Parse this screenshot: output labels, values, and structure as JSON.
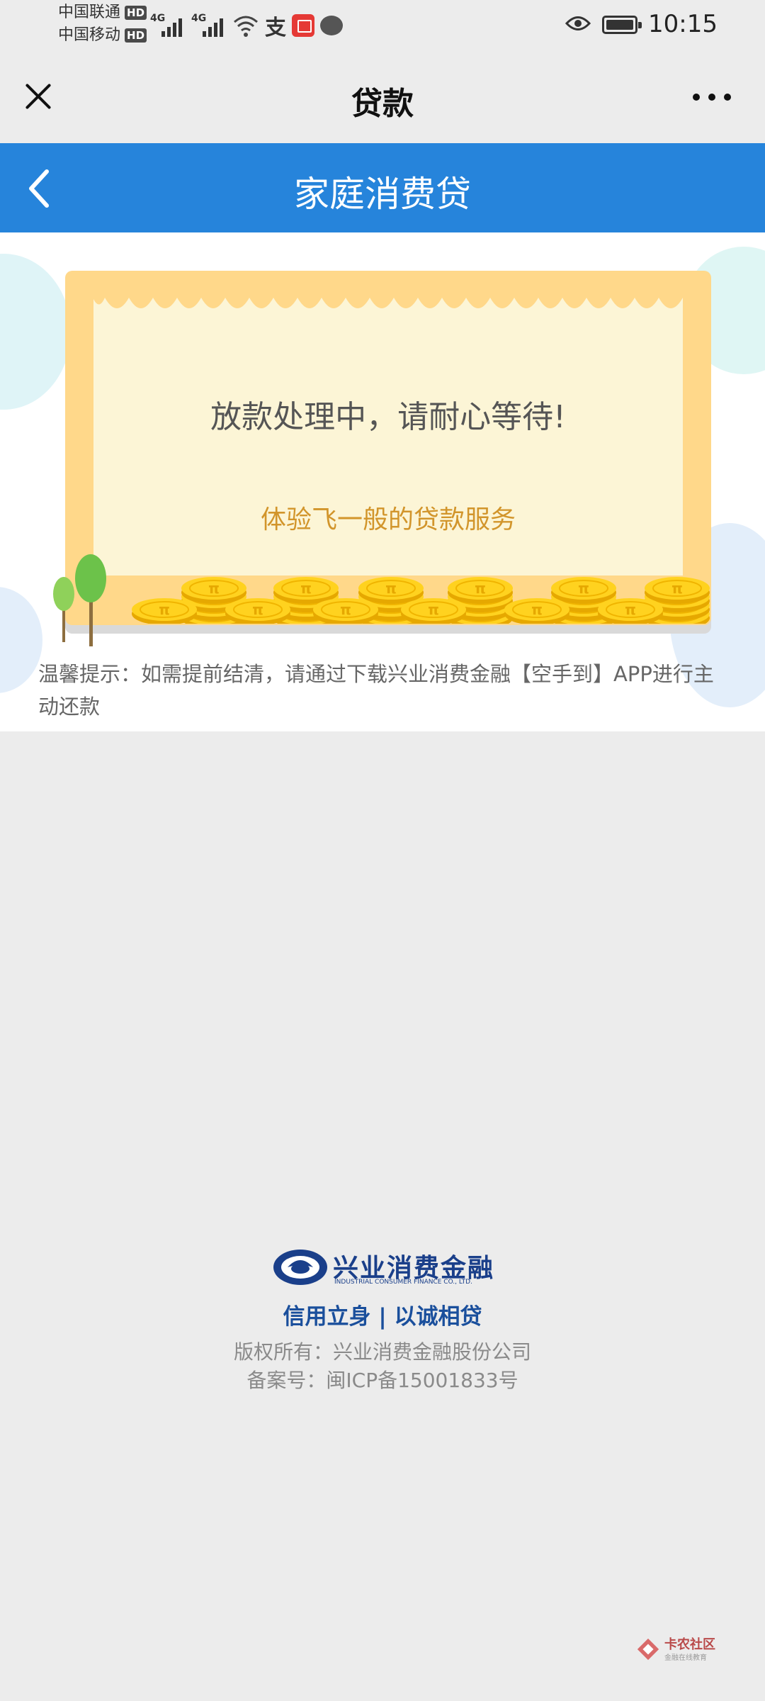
{
  "status_bar": {
    "carrier1": "中国联通",
    "carrier2": "中国移动",
    "hd_badge": "HD",
    "network_tag": "4G",
    "time": "10:15",
    "icons": [
      "signal-icon",
      "wifi-icon",
      "alipay-icon",
      "book-app-icon",
      "chat-icon",
      "eye-icon",
      "battery-icon"
    ]
  },
  "top_nav": {
    "title": "贷款",
    "close_icon": "close-icon",
    "more_icon": "more-icon"
  },
  "header": {
    "title": "家庭消费贷",
    "back_icon": "chevron-left-icon"
  },
  "card": {
    "message": "放款处理中，请耐心等待!",
    "subtext": "体验飞一般的贷款服务"
  },
  "tip": "温馨提示：如需提前结清，请通过下载兴业消费金融【空手到】APP进行主动还款",
  "footer": {
    "logo_text": "兴业消费金融",
    "logo_subtext": "INDUSTRIAL CONSUMER FINANCE CO., LTD.",
    "slogan": "信用立身 | 以诚相贷",
    "copyright": "版权所有：兴业消费金融股份公司",
    "icp": "备案号：闽ICP备15001833号"
  },
  "watermark": {
    "text": "卡农社区",
    "subtext": "金融在线教育"
  },
  "colors": {
    "header_blue": "#2684db",
    "frame_yellow": "#ffd88a",
    "panel_cream": "#fcf5d6",
    "subtext_gold": "#d2952b",
    "brand_navy": "#1a3f8a"
  }
}
